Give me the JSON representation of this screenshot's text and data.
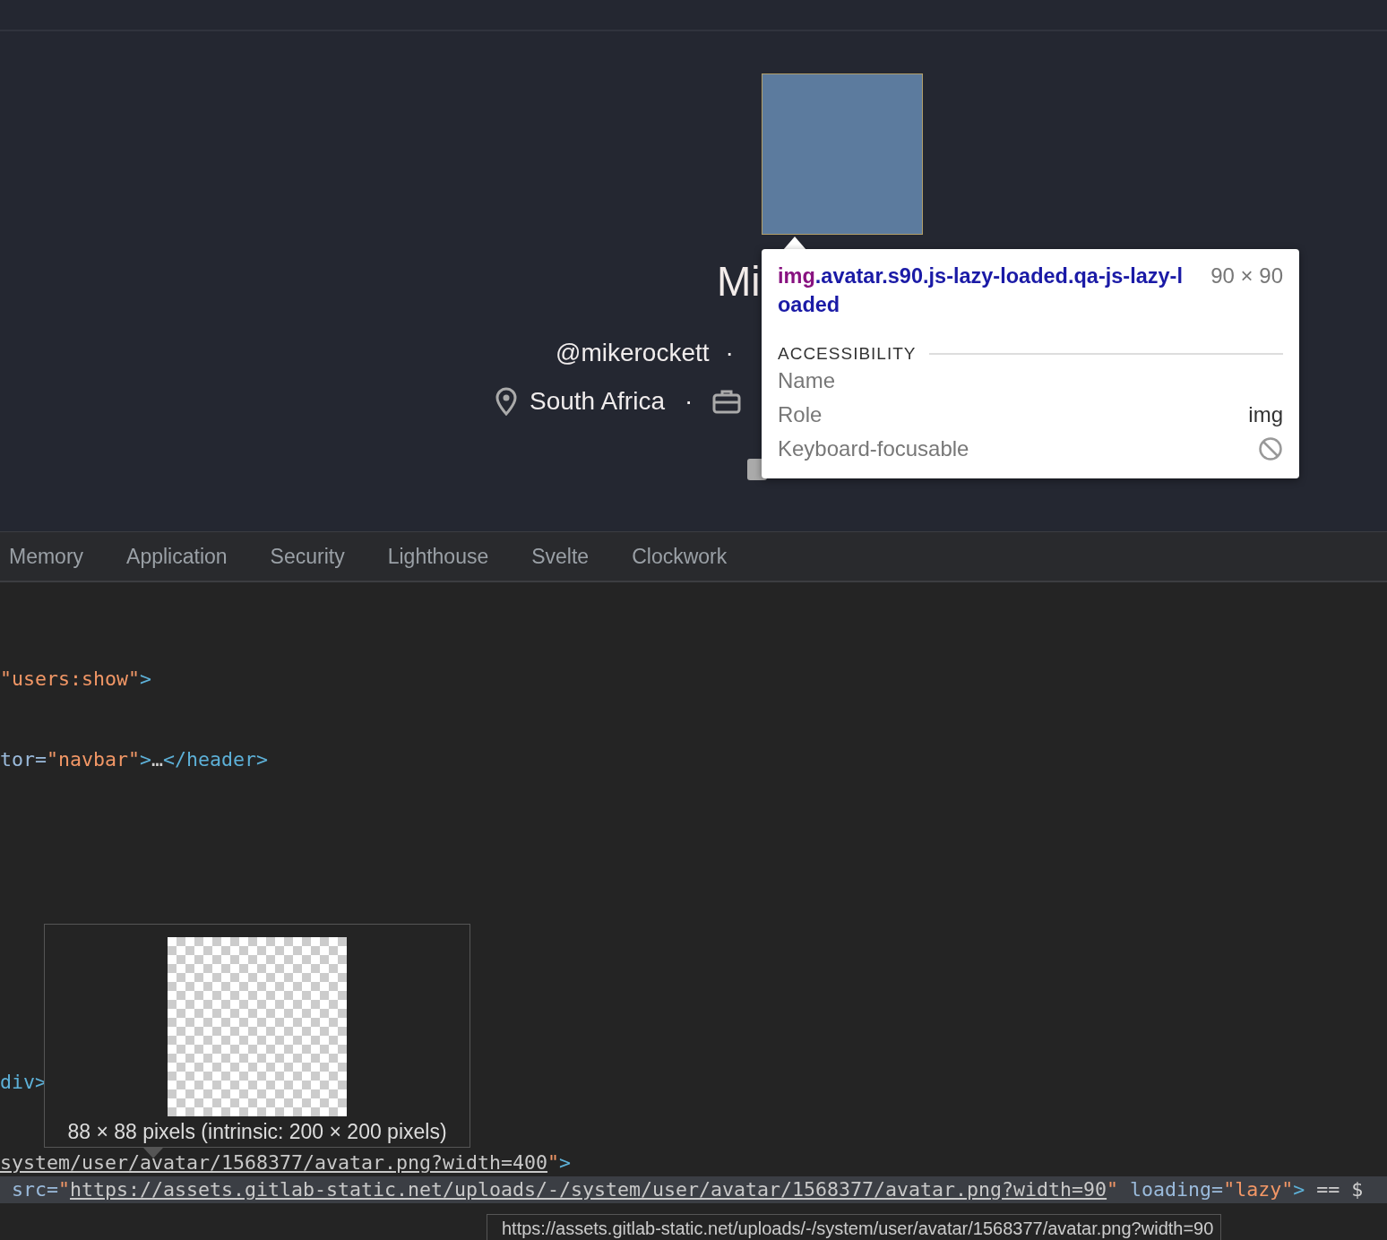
{
  "profile": {
    "name": "Mi",
    "handle": "@mikerockett",
    "location": "South Africa",
    "separator": "·"
  },
  "tabs": [
    {
      "label": "Memory",
      "selected": false
    },
    {
      "label": "Application",
      "selected": false
    },
    {
      "label": "Security",
      "selected": false
    },
    {
      "label": "Lighthouse",
      "selected": false
    },
    {
      "label": "Svelte",
      "selected": false
    },
    {
      "label": "Clockwork",
      "selected": false
    }
  ],
  "code_lines": [
    {
      "selected": false,
      "parts": [
        {
          "kind": "value",
          "text": "\"users:show\""
        },
        {
          "kind": "tag",
          "text": ">"
        }
      ]
    },
    {
      "selected": false,
      "parts": [
        {
          "kind": "attr",
          "text": "tor="
        },
        {
          "kind": "value",
          "text": "\"navbar\""
        },
        {
          "kind": "tag",
          "text": ">"
        },
        {
          "kind": "text",
          "text": "…"
        },
        {
          "kind": "tag",
          "text": "</header>"
        }
      ]
    },
    {
      "selected": false,
      "parts": [
        {
          "kind": "tag",
          "text": "div>"
        }
      ]
    },
    {
      "selected": false,
      "parts": [
        {
          "kind": "link",
          "text": "system/user/avatar/1568377/avatar.png?width=400"
        },
        {
          "kind": "value",
          "text": "\""
        },
        {
          "kind": "tag",
          "text": ">"
        }
      ]
    },
    {
      "selected": true,
      "parts": [
        {
          "kind": "attr",
          "text": " src="
        },
        {
          "kind": "value",
          "text": "\""
        },
        {
          "kind": "link",
          "text": "https://assets.gitlab-static.net/uploads/-/system/user/avatar/1568377/avatar.png?width=90"
        },
        {
          "kind": "value",
          "text": "\""
        },
        {
          "kind": "attr",
          "text": " loading="
        },
        {
          "kind": "value",
          "text": "\"lazy\""
        },
        {
          "kind": "tag",
          "text": ">"
        },
        {
          "kind": "text",
          "text": " == $"
        }
      ]
    }
  ],
  "element_tooltip": {
    "tag": "img",
    "classes": ".avatar.s90.js-lazy-loaded.qa-js-lazy-loaded",
    "size": "90 × 90",
    "section": "ACCESSIBILITY",
    "rows": [
      {
        "label": "Name",
        "kind": "text"
      },
      {
        "label": "Role",
        "kind": "text",
        "value": "img"
      },
      {
        "label": "Keyboard-focusable",
        "kind": "flag",
        "on": false
      }
    ]
  },
  "image_preview": {
    "caption": "88 × 88 pixels (intrinsic: 200 × 200 pixels)"
  },
  "url_tooltip": "https://assets.gitlab-static.net/uploads/-/system/user/avatar/1568377/avatar.png?width=90"
}
